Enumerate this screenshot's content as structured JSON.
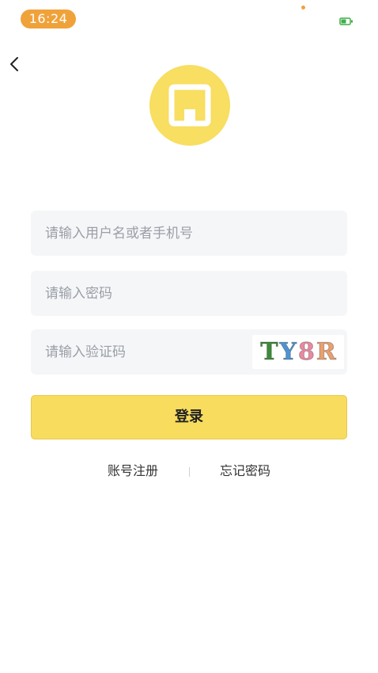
{
  "status_bar": {
    "time": "16:24",
    "time_bg": "#f0a23a",
    "battery": "battery-charging-icon"
  },
  "nav": {
    "back_icon": "chevron-left-icon"
  },
  "logo": {
    "icon": "store-icon",
    "color": "#f8de61"
  },
  "form": {
    "username_placeholder": "请输入用户名或者手机号",
    "password_placeholder": "请输入密码",
    "captcha_placeholder": "请输入验证码",
    "captcha_chars": [
      {
        "char": "T",
        "color": "#3e8a3b"
      },
      {
        "char": "Y",
        "color": "#4f93d1"
      },
      {
        "char": "8",
        "color": "#e88aa0"
      },
      {
        "char": "R",
        "color": "#e8a070"
      }
    ],
    "field_bg": "#f5f6f8"
  },
  "login_button": {
    "label": "登录",
    "color": "#f8dc5e"
  },
  "links": {
    "register": "账号注册",
    "forgot": "忘记密码"
  }
}
